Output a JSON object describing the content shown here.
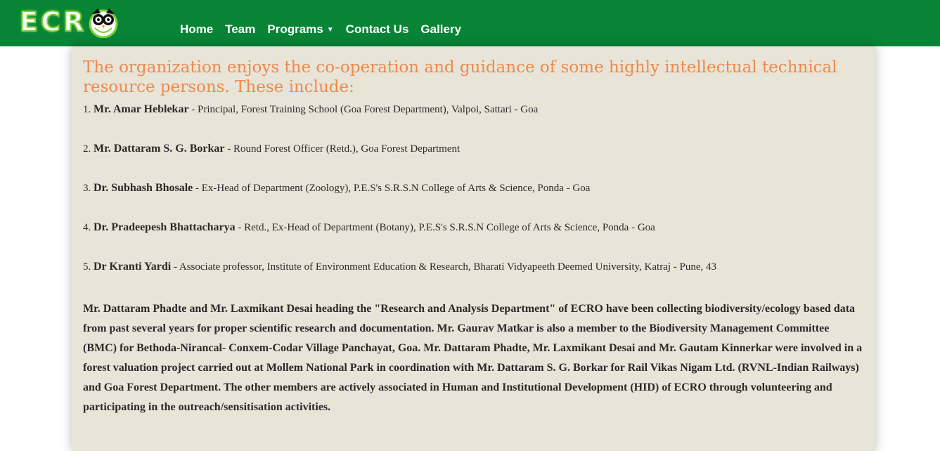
{
  "header": {
    "logo_text": "ECR",
    "nav": [
      "Home",
      "Team",
      "Programs",
      "Contact Us",
      "Gallery"
    ],
    "accent_color": "#088437"
  },
  "main": {
    "intro": "The organization enjoys the co-operation and guidance of some highly intellectual technical resource persons. These include:",
    "people": [
      {
        "num": "1.",
        "name": "Mr. Amar Heblekar",
        "desc": " - Principal, Forest Training School (Goa Forest Department), Valpoi, Sattari - Goa"
      },
      {
        "num": "2.",
        "name": "Mr. Dattaram S. G. Borkar",
        "desc": " - Round Forest Officer (Retd.), Goa Forest Department"
      },
      {
        "num": "3.",
        "name": "Dr. Subhash Bhosale",
        "desc": " - Ex-Head of Department (Zoology), P.E.S's S.R.S.N College of Arts & Science, Ponda - Goa"
      },
      {
        "num": "4.",
        "name": "Dr. Pradeepesh Bhattacharya",
        "desc": " - Retd., Ex-Head of Department (Botany), P.E.S's S.R.S.N College of Arts & Science, Ponda - Goa"
      },
      {
        "num": "5.",
        "name": "Dr Kranti Yardi",
        "desc": " - Associate professor, Institute of Environment Education & Research, Bharati Vidyapeeth Deemed University, Katraj - Pune, 43"
      }
    ],
    "summary": "Mr. Dattaram Phadte and Mr. Laxmikant Desai heading the \"Research and Analysis Department\" of ECRO have been collecting biodiversity/ecology based data from past several years for proper scientific research and documentation. Mr. Gaurav Matkar is also a member to the Biodiversity Management Committee (BMC) for Bethoda-Nirancal- Conxem-Codar Village Panchayat, Goa. Mr. Dattaram Phadte, Mr. Laxmikant Desai and Mr. Gautam Kinnerkar were involved in a forest valuation project carried out at Mollem National Park in coordination with Mr. Dattaram S. G. Borkar for Rail Vikas Nigam Ltd. (RVNL-Indian Railways) and Goa Forest Department. The other members are actively associated in Human and Institutional Development (HID) of ECRO through volunteering and participating in the outreach/sensitisation activities.",
    "background_color": "#e8e4d8",
    "intro_color": "#ef8a4a"
  }
}
